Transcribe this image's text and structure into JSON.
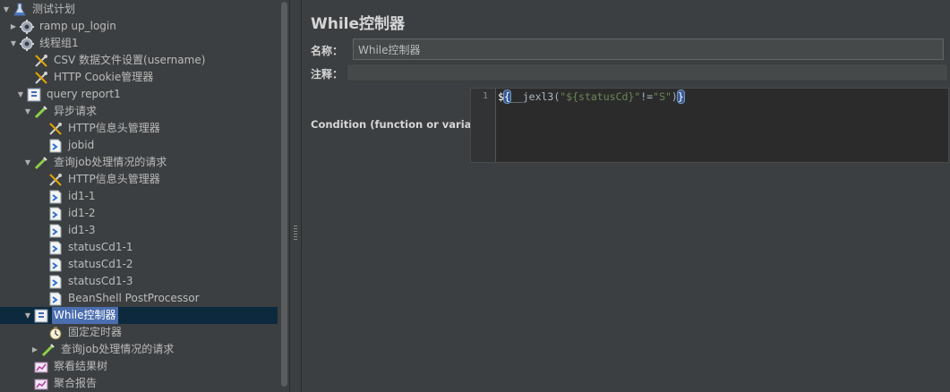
{
  "tree": {
    "items": [
      {
        "label": "测试计划",
        "icon": "test-plan-icon",
        "toggle": "expanded"
      },
      {
        "label": "ramp up_login",
        "icon": "thread-group-icon",
        "toggle": "collapsed"
      },
      {
        "label": "线程组1",
        "icon": "thread-group-icon",
        "toggle": "expanded"
      },
      {
        "label": "CSV 数据文件设置(username)",
        "icon": "config-element-icon",
        "toggle": ""
      },
      {
        "label": "HTTP Cookie管理器",
        "icon": "config-element-icon",
        "toggle": ""
      },
      {
        "label": "query report1",
        "icon": "logic-controller-icon",
        "toggle": "expanded"
      },
      {
        "label": "异步请求",
        "icon": "sampler-icon",
        "toggle": "expanded"
      },
      {
        "label": "HTTP信息头管理器",
        "icon": "config-element-icon",
        "toggle": ""
      },
      {
        "label": "jobid",
        "icon": "post-processor-icon",
        "toggle": ""
      },
      {
        "label": "查询job处理情况的请求",
        "icon": "sampler-icon",
        "toggle": "expanded"
      },
      {
        "label": "HTTP信息头管理器",
        "icon": "config-element-icon",
        "toggle": ""
      },
      {
        "label": "id1-1",
        "icon": "post-processor-icon",
        "toggle": ""
      },
      {
        "label": "id1-2",
        "icon": "post-processor-icon",
        "toggle": ""
      },
      {
        "label": "id1-3",
        "icon": "post-processor-icon",
        "toggle": ""
      },
      {
        "label": "statusCd1-1",
        "icon": "post-processor-icon",
        "toggle": ""
      },
      {
        "label": "statusCd1-2",
        "icon": "post-processor-icon",
        "toggle": ""
      },
      {
        "label": "statusCd1-3",
        "icon": "post-processor-icon",
        "toggle": ""
      },
      {
        "label": "BeanShell PostProcessor",
        "icon": "post-processor-icon",
        "toggle": ""
      },
      {
        "label": "While控制器",
        "icon": "logic-controller-icon",
        "toggle": "expanded",
        "selected": true
      },
      {
        "label": "固定定时器",
        "icon": "timer-icon",
        "toggle": ""
      },
      {
        "label": "查询job处理情况的请求",
        "icon": "sampler-icon",
        "toggle": "collapsed"
      },
      {
        "label": "察看结果树",
        "icon": "listener-icon",
        "toggle": ""
      },
      {
        "label": "聚合报告",
        "icon": "listener-icon",
        "toggle": ""
      }
    ]
  },
  "panel": {
    "title": "While控制器",
    "name_label": "名称：",
    "name_value": "While控制器",
    "comment_label": "注释：",
    "comment_value": "",
    "condition_label": "Condition (function or variable)",
    "line_number": "1",
    "code": {
      "dollar": "$",
      "open_brace": "{",
      "func": "__jexl3(",
      "str1": "\"${statusCd}\"",
      "op": "!=",
      "str2": "\"S\"",
      "close_paren": ")",
      "close_brace": "}"
    }
  },
  "colors": {
    "background": "#3c3f41",
    "selection_row": "#0d293e",
    "selection_label": "#4b6eaf",
    "editor_bg": "#2b2b2b",
    "string_green": "#6a8759"
  }
}
